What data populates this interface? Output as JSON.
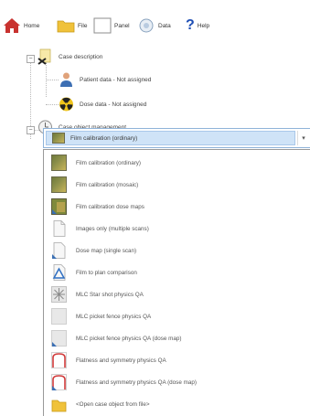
{
  "toolbar": {
    "home_label": "Home",
    "file_label": "File",
    "panel_label": "Panel",
    "data_label": "Data",
    "help_label": "Help"
  },
  "tree": {
    "case_description": {
      "label": "Case description",
      "patient": "Patient data - Not assigned",
      "dose": "Dose data - Not assigned"
    },
    "case_object_management": {
      "label": "Case object management",
      "selected": "Film calibration (ordinary)"
    }
  },
  "dropdown": {
    "options": [
      {
        "label": "Film calibration (ordinary)",
        "icon": "film-calibration-icon"
      },
      {
        "label": "Film calibration (mosaic)",
        "icon": "film-calibration-icon"
      },
      {
        "label": "Film calibration dose maps",
        "icon": "film-dose-map-icon"
      },
      {
        "label": "Images only (multiple scans)",
        "icon": "document-icon"
      },
      {
        "label": "Dose map (single scan)",
        "icon": "dose-map-icon"
      },
      {
        "label": "Film to plan comparison",
        "icon": "comparison-icon"
      },
      {
        "label": "MLC Star shot physics QA",
        "icon": "star-shot-icon"
      },
      {
        "label": "MLC picket fence physics QA",
        "icon": "picket-fence-icon"
      },
      {
        "label": "MLC picket fence physics QA (dose map)",
        "icon": "picket-fence-dose-icon"
      },
      {
        "label": "Flatness and symmetry physics QA",
        "icon": "flatness-icon"
      },
      {
        "label": "Flatness and symmetry physics QA (dose map)",
        "icon": "flatness-dose-icon"
      },
      {
        "label": "<Open case object from file>",
        "icon": "folder-icon"
      }
    ]
  },
  "colors": {
    "accent_border": "#8fb3d9",
    "selection": "#cfe3f7",
    "home_red": "#c8322f",
    "help_blue": "#1f4fb5"
  }
}
